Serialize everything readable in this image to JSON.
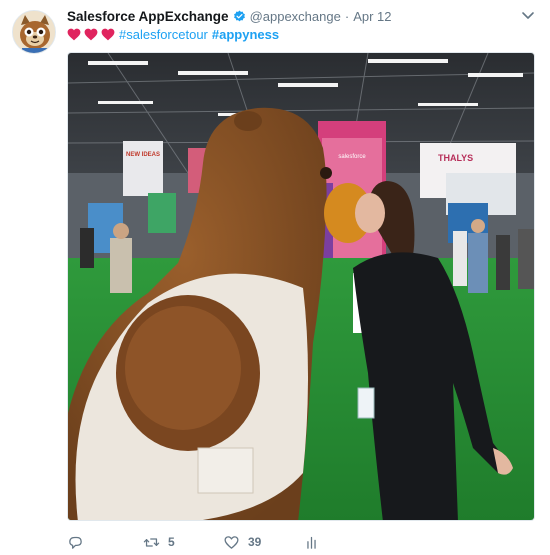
{
  "tweet": {
    "display_name": "Salesforce AppExchange",
    "handle": "@appexchange",
    "separator": "·",
    "date": "Apr 12",
    "hashtags": [
      "#salesforcetour",
      "#appyness"
    ],
    "hearts_count_icons": [
      "heart-icon",
      "heart-icon",
      "heart-icon"
    ],
    "heart_color": "#e0245e",
    "link_color": "#1da1f2",
    "verified_color": "#1da1f2",
    "photo_signage": {
      "left_banner": "NEW IDEAS",
      "center_logo": "salesforce",
      "right_banner": "THALYS"
    }
  },
  "actions": {
    "reply_icon": "reply-icon",
    "retweet_icon": "retweet-icon",
    "retweet_count": "5",
    "like_icon": "like-icon",
    "like_count": "39",
    "analytics_icon": "analytics-icon"
  }
}
